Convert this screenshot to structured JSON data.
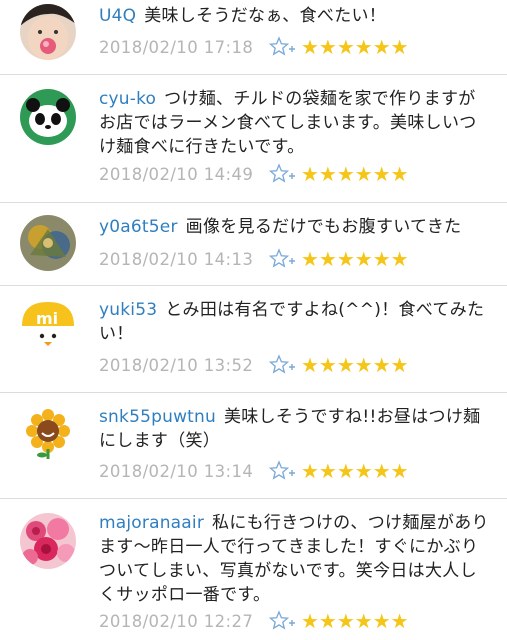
{
  "comments": [
    {
      "user": "U4Q",
      "text": "美味しそうだなぁ、食べたい！",
      "date": "2018/02/10 17:18",
      "avatar": "child-avatar"
    },
    {
      "user": "cyu-ko",
      "text": "つけ麺、チルドの袋麺を家で作りますがお店ではラーメン食べてしまいます。美味しいつけ麺食べに行きたいです。",
      "date": "2018/02/10 14:49",
      "avatar": "panda-avatar"
    },
    {
      "user": "y0a6t5er",
      "text": "画像を見るだけでもお腹すいてきた",
      "date": "2018/02/10 14:13",
      "avatar": "painting-avatar"
    },
    {
      "user": "yuki53",
      "text": "とみ田は有名ですよね(^^)！食べてみたい！",
      "date": "2018/02/10 13:52",
      "avatar": "mi-chick-avatar"
    },
    {
      "user": "snk55puwtnu",
      "text": "美味しそうですね!!お昼はつけ麺にします（笑）",
      "date": "2018/02/10 13:14",
      "avatar": "sunflower-avatar"
    },
    {
      "user": "majoranaair",
      "text": "私にも行きつけの、つけ麺屋があります〜昨日一人で行ってきました！すぐにかぶりついてしまい、写真がないです。笑今日は大人しくサッポロ一番です。",
      "date": "2018/02/10 12:27",
      "avatar": "roses-avatar"
    }
  ],
  "rating_stars": "★★★★★★",
  "icons": {
    "favorite": "star-plus-icon"
  },
  "colors": {
    "username": "#2f7fc0",
    "star": "#f5c518",
    "date": "#b5b5b5"
  }
}
